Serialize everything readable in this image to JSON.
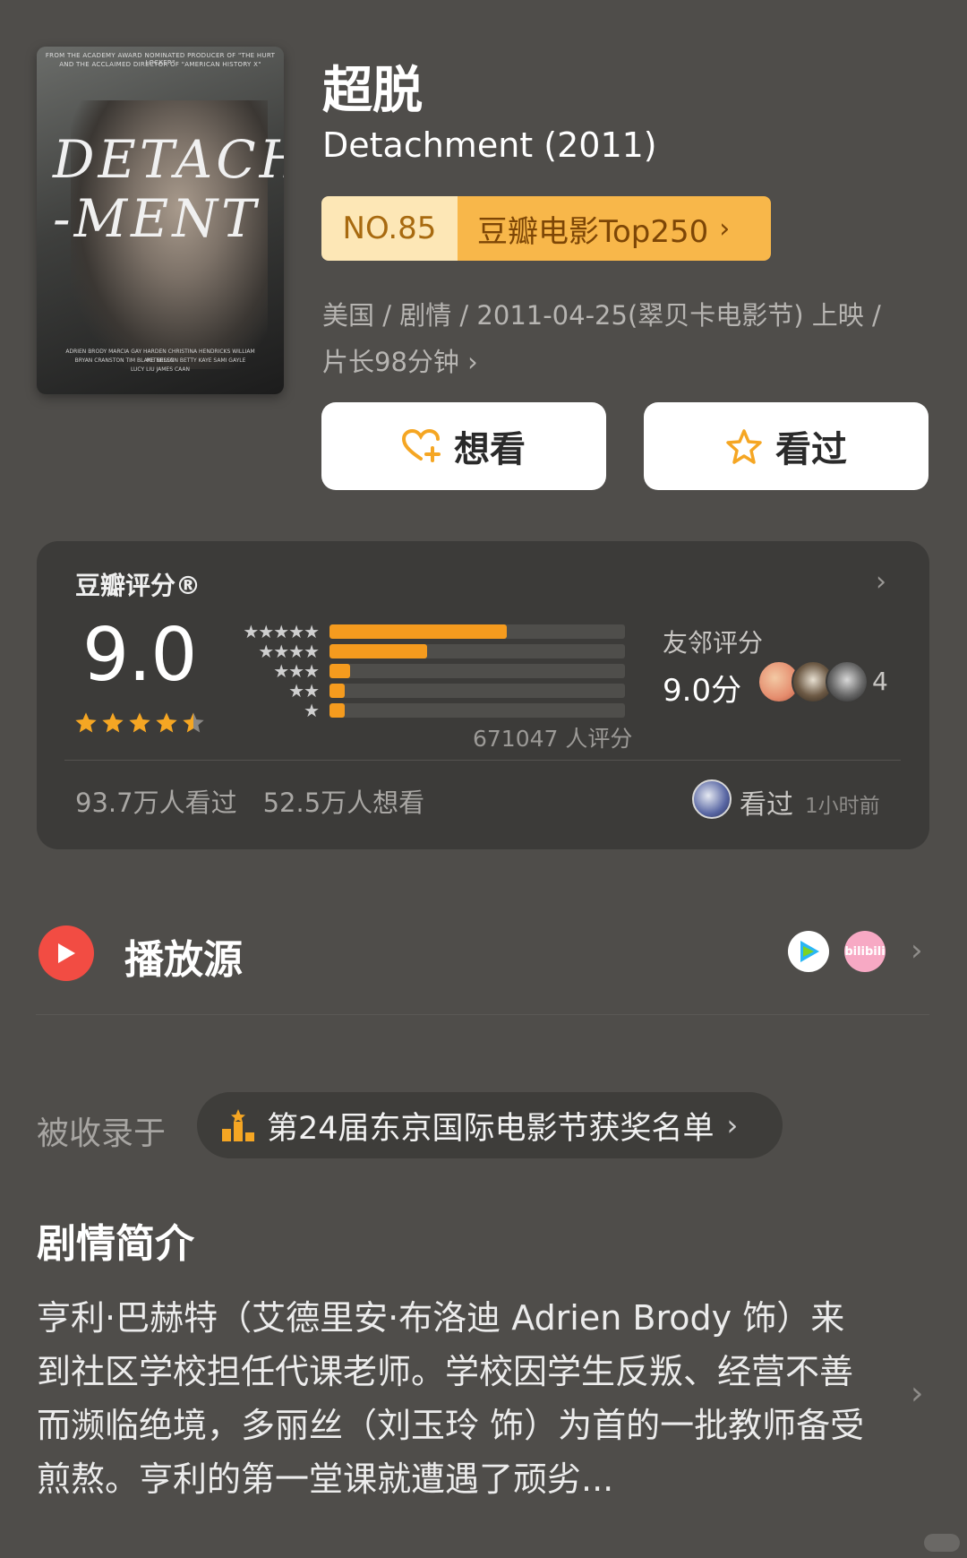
{
  "poster": {
    "credit_line1": "FROM THE ACADEMY AWARD NOMINATED PRODUCER OF \"THE HURT LOCKER\"",
    "credit_line2": "AND THE ACCLAIMED DIRECTOR OF \"AMERICAN HISTORY X\"",
    "title_line1": "DETACH",
    "title_line2": "-MENT",
    "cast_line1": "ADRIEN BRODY   MARCIA GAY HARDEN   CHRISTINA HENDRICKS   WILLIAM PETERSEN",
    "cast_line2": "BRYAN CRANSTON   TIM BLAKE NELSON   BETTY KAYE   SAMI GAYLE",
    "cast_line3": "LUCY LIU   JAMES CAAN"
  },
  "movie": {
    "title_cn": "超脱",
    "title_en": "Detachment (2011)"
  },
  "rank": {
    "number": "NO.85",
    "list": "豆瓣电影Top250",
    "chevron": "›"
  },
  "meta": {
    "line1": "美国 / 剧情 / 2011-04-25(翠贝卡电影节) 上映 /",
    "line2": "片长98分钟 ›"
  },
  "actions": {
    "want_label": "想看",
    "seen_label": "看过"
  },
  "rating": {
    "title": "豆瓣评分®",
    "score": "9.0",
    "stars_value": 4.5,
    "distribution": [
      {
        "label": "★★★★★",
        "percent": 60
      },
      {
        "label": "★★★★",
        "percent": 33
      },
      {
        "label": "★★★",
        "percent": 7
      },
      {
        "label": "★★",
        "percent": 5
      },
      {
        "label": "★",
        "percent": 5
      }
    ],
    "count_text": "671047 人评分",
    "friend_label": "友邻评分",
    "friend_score": "9.0分",
    "friend_count": "4",
    "watched_stats": "93.7万人看过　52.5万人想看",
    "recent_label": "看过",
    "recent_time": "1小时前",
    "accent_color": "#f59b1e"
  },
  "play": {
    "label": "播放源",
    "source2_text": "bilibili"
  },
  "collected": {
    "label": "被收录于",
    "list_name": "第24届东京国际电影节获奖名单",
    "chevron": "›"
  },
  "intro": {
    "title": "剧情简介",
    "text": "亨利·巴赫特（艾德里安·布洛迪 Adrien Brody 饰）来到社区学校担任代课老师。学校因学生反叛、经营不善而濒临绝境，多丽丝（刘玉玲 饰）为首的一批教师备受煎熬。亨利的第一堂课就遭遇了顽劣..."
  }
}
